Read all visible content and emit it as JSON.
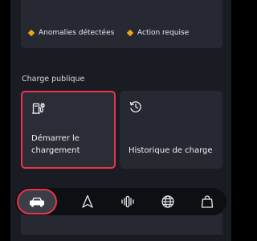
{
  "status": {
    "left_label": "Anomalies détectées",
    "right_label": "Action requise",
    "indicator_color": "#f0a417"
  },
  "public_charging": {
    "section_title": "Charge publique",
    "start_charging_label": "Démarrer le chargement",
    "charge_history_label": "Historique de charge",
    "start_charging_icon": "ev-charger-icon",
    "charge_history_icon": "history-icon"
  },
  "nav": {
    "items": [
      {
        "icon": "car-icon",
        "active": true
      },
      {
        "icon": "navigation-icon",
        "active": false
      },
      {
        "icon": "voice-icon",
        "active": false
      },
      {
        "icon": "globe-icon",
        "active": false
      },
      {
        "icon": "shopping-bag-icon",
        "active": false
      }
    ],
    "highlight_color": "#e8344a"
  }
}
